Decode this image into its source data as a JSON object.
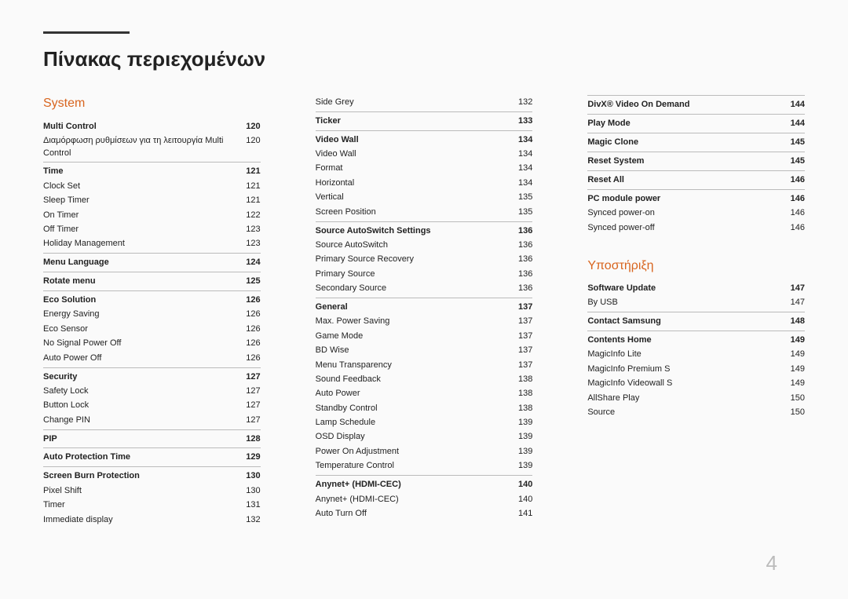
{
  "page_number": "4",
  "title": "Πίνακας περιεχομένων",
  "chapters": [
    {
      "heading": "System",
      "groups": [
        {
          "header": {
            "label": "Multi Control",
            "page": "120"
          },
          "items": [
            {
              "label": "Διαμόρφωση ρυθμίσεων για τη λειτουργία Multi Control",
              "page": "120"
            }
          ]
        },
        {
          "header": {
            "label": "Time",
            "page": "121"
          },
          "items": [
            {
              "label": "Clock Set",
              "page": "121"
            },
            {
              "label": "Sleep Timer",
              "page": "121"
            },
            {
              "label": "On Timer",
              "page": "122"
            },
            {
              "label": "Off Timer",
              "page": "123"
            },
            {
              "label": "Holiday Management",
              "page": "123"
            }
          ]
        },
        {
          "header": {
            "label": "Menu Language",
            "page": "124"
          },
          "items": []
        },
        {
          "header": {
            "label": "Rotate menu",
            "page": "125"
          },
          "items": []
        },
        {
          "header": {
            "label": "Eco Solution",
            "page": "126"
          },
          "items": [
            {
              "label": "Energy Saving",
              "page": "126"
            },
            {
              "label": "Eco Sensor",
              "page": "126"
            },
            {
              "label": "No Signal Power Off",
              "page": "126"
            },
            {
              "label": "Auto Power Off",
              "page": "126"
            }
          ]
        },
        {
          "header": {
            "label": "Security",
            "page": "127"
          },
          "items": [
            {
              "label": "Safety Lock",
              "page": "127"
            },
            {
              "label": "Button Lock",
              "page": "127"
            },
            {
              "label": "Change PIN",
              "page": "127"
            }
          ]
        },
        {
          "header": {
            "label": "PIP",
            "page": "128"
          },
          "items": []
        },
        {
          "header": {
            "label": "Auto Protection Time",
            "page": "129"
          },
          "items": []
        },
        {
          "header": {
            "label": "Screen Burn Protection",
            "page": "130"
          },
          "items": [
            {
              "label": "Pixel Shift",
              "page": "130"
            },
            {
              "label": "Timer",
              "page": "131"
            },
            {
              "label": "Immediate display",
              "page": "132"
            },
            {
              "label": "Side Grey",
              "page": "132"
            }
          ]
        },
        {
          "header": {
            "label": "Ticker",
            "page": "133"
          },
          "items": []
        },
        {
          "header": {
            "label": "Video Wall",
            "page": "134"
          },
          "items": [
            {
              "label": "Video Wall",
              "page": "134"
            },
            {
              "label": "Format",
              "page": "134"
            },
            {
              "label": "Horizontal",
              "page": "134"
            },
            {
              "label": "Vertical",
              "page": "135"
            },
            {
              "label": "Screen Position",
              "page": "135"
            }
          ]
        },
        {
          "header": {
            "label": "Source AutoSwitch Settings",
            "page": "136"
          },
          "items": [
            {
              "label": "Source AutoSwitch",
              "page": "136"
            },
            {
              "label": "Primary Source Recovery",
              "page": "136"
            },
            {
              "label": "Primary Source",
              "page": "136"
            },
            {
              "label": "Secondary Source",
              "page": "136"
            }
          ]
        },
        {
          "header": {
            "label": "General",
            "page": "137"
          },
          "items": [
            {
              "label": "Max. Power Saving",
              "page": "137"
            },
            {
              "label": "Game Mode",
              "page": "137"
            },
            {
              "label": "BD Wise",
              "page": "137"
            },
            {
              "label": "Menu Transparency",
              "page": "137"
            },
            {
              "label": "Sound Feedback",
              "page": "138"
            },
            {
              "label": "Auto Power",
              "page": "138"
            },
            {
              "label": "Standby Control",
              "page": "138"
            },
            {
              "label": "Lamp Schedule",
              "page": "139"
            },
            {
              "label": "OSD Display",
              "page": "139"
            },
            {
              "label": "Power On Adjustment",
              "page": "139"
            },
            {
              "label": "Temperature Control",
              "page": "139"
            }
          ]
        },
        {
          "header": {
            "label": "Anynet+ (HDMI-CEC)",
            "page": "140"
          },
          "items": [
            {
              "label": "Anynet+ (HDMI-CEC)",
              "page": "140"
            },
            {
              "label": "Auto Turn Off",
              "page": "141"
            }
          ]
        },
        {
          "header": {
            "label": "DivX® Video On Demand",
            "page": "144"
          },
          "items": []
        },
        {
          "header": {
            "label": "Play Mode",
            "page": "144"
          },
          "items": []
        },
        {
          "header": {
            "label": "Magic Clone",
            "page": "145"
          },
          "items": []
        },
        {
          "header": {
            "label": "Reset System",
            "page": "145"
          },
          "items": []
        },
        {
          "header": {
            "label": "Reset All",
            "page": "146"
          },
          "items": []
        },
        {
          "header": {
            "label": "PC module power",
            "page": "146"
          },
          "items": [
            {
              "label": "Synced power-on",
              "page": "146"
            },
            {
              "label": "Synced power-off",
              "page": "146"
            }
          ]
        }
      ]
    },
    {
      "heading": "Υποστήριξη",
      "groups": [
        {
          "header": {
            "label": "Software Update",
            "page": "147"
          },
          "items": [
            {
              "label": "By USB",
              "page": "147"
            }
          ]
        },
        {
          "header": {
            "label": "Contact Samsung",
            "page": "148"
          },
          "items": []
        },
        {
          "header": {
            "label": "Contents Home",
            "page": "149"
          },
          "items": [
            {
              "label": "MagicInfo Lite",
              "page": "149"
            },
            {
              "label": "MagicInfo Premium S",
              "page": "149"
            },
            {
              "label": "MagicInfo Videowall S",
              "page": "149"
            },
            {
              "label": "AllShare Play",
              "page": "150"
            },
            {
              "label": "Source",
              "page": "150"
            }
          ]
        }
      ]
    }
  ]
}
